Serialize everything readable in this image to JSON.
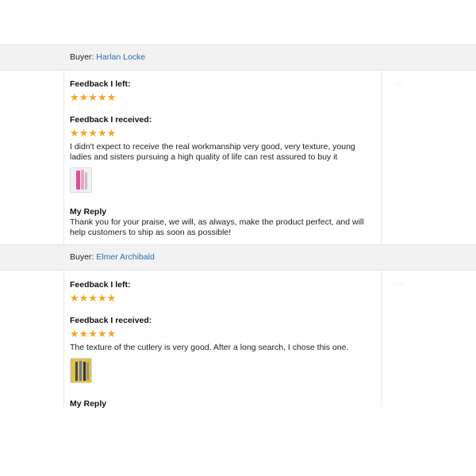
{
  "entries": [
    {
      "buyer_label": "Buyer:",
      "buyer_name": "Harlan Locke",
      "left_heading": "Feedback I left:",
      "left_stars": "★★★★★",
      "received_heading": "Feedback I received:",
      "received_stars": "★★★★★",
      "comment": "I didn't expect to receive the real workmanship very good, very texture, young ladies and sisters pursuing a high quality of life can rest assured to buy it",
      "reply_heading": "My Reply",
      "reply_text": "Thank you for your praise, we will, as always, make the product perfect, and will help customers to ship as soon as possible!"
    },
    {
      "buyer_label": "Buyer:",
      "buyer_name": "Elmer Archibald",
      "left_heading": "Feedback I left:",
      "left_stars": "★★★★★",
      "received_heading": "Feedback I received:",
      "received_stars": "★★★★★",
      "comment": "The texture of the cutlery is very good. After a long search, I chose this one.",
      "reply_heading": "My Reply"
    }
  ],
  "colors": {
    "star": "#f5a623",
    "link": "#2a6db0",
    "bar": "#f2f2f2"
  }
}
